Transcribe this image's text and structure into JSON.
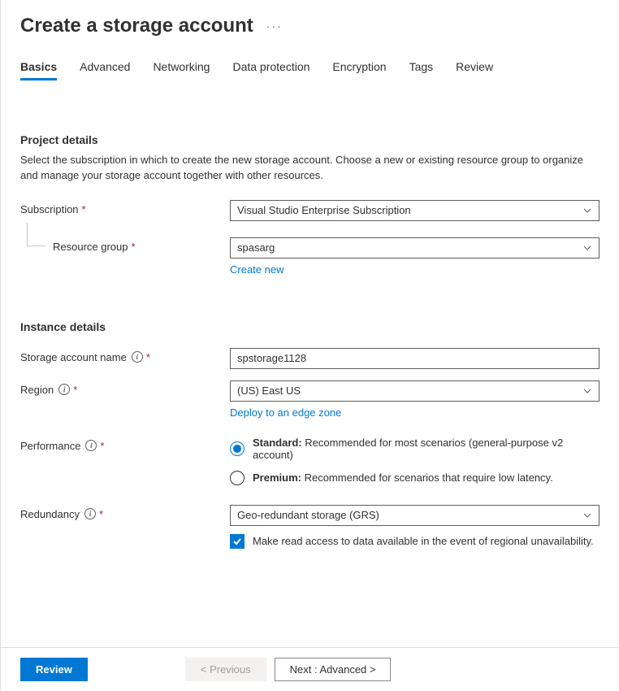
{
  "header": {
    "title": "Create a storage account",
    "ellipsis": "···"
  },
  "tabs": [
    {
      "label": "Basics",
      "active": true
    },
    {
      "label": "Advanced",
      "active": false
    },
    {
      "label": "Networking",
      "active": false
    },
    {
      "label": "Data protection",
      "active": false
    },
    {
      "label": "Encryption",
      "active": false
    },
    {
      "label": "Tags",
      "active": false
    },
    {
      "label": "Review",
      "active": false
    }
  ],
  "project": {
    "title": "Project details",
    "desc": "Select the subscription in which to create the new storage account. Choose a new or existing resource group to organize and manage your storage account together with other resources.",
    "subscription_label": "Subscription",
    "subscription_value": "Visual Studio Enterprise Subscription",
    "rg_label": "Resource group",
    "rg_value": "spasarg",
    "create_new": "Create new"
  },
  "instance": {
    "title": "Instance details",
    "name_label": "Storage account name",
    "name_value": "spstorage1128",
    "region_label": "Region",
    "region_value": "(US) East US",
    "edge_link": "Deploy to an edge zone",
    "perf_label": "Performance",
    "perf_standard_bold": "Standard:",
    "perf_standard_desc": " Recommended for most scenarios (general-purpose v2 account)",
    "perf_premium_bold": "Premium:",
    "perf_premium_desc": " Recommended for scenarios that require low latency.",
    "redundancy_label": "Redundancy",
    "redundancy_value": "Geo-redundant storage (GRS)",
    "ra_checkbox": "Make read access to data available in the event of regional unavailability."
  },
  "footer": {
    "review": "Review",
    "previous": "< Previous",
    "next": "Next : Advanced >"
  }
}
